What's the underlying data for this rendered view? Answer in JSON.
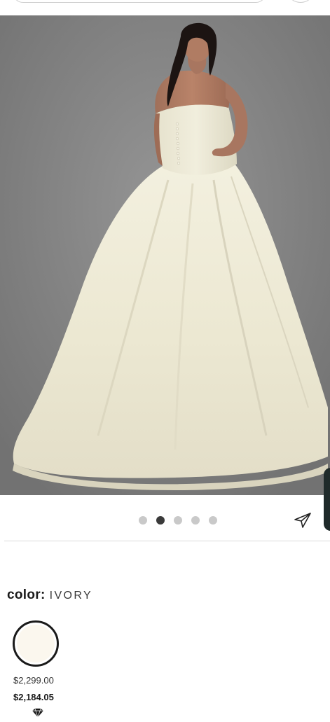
{
  "product": {
    "image_alt": "Strapless ivory ball gown wedding dress, back view",
    "gallery": {
      "dot_count": 5,
      "active_index": 1
    }
  },
  "icons": {
    "share": "share-arrow-icon",
    "badge": "diamond-icon"
  },
  "color": {
    "label": "color:",
    "value": "IVORY",
    "swatch_hex": "#fbf7ee"
  },
  "pricing": {
    "original": "$2,299.00",
    "sale": "$2,184.05"
  },
  "colors": {
    "active_dot": "#3a3a3a",
    "inactive_dot": "#c9c9c9",
    "side_tab": "#1f2a2a"
  }
}
